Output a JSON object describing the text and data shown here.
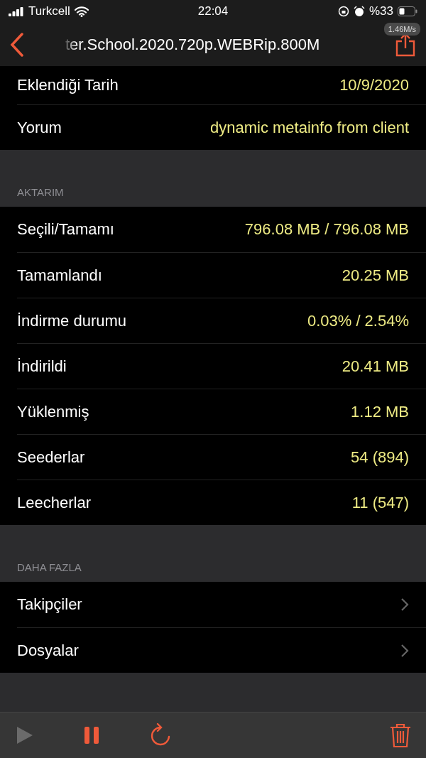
{
  "status_bar": {
    "carrier": "Turkcell",
    "time": "22:04",
    "battery": "%33"
  },
  "nav": {
    "title": "ter.School.2020.720p.WEBRip.800M",
    "speed": "1.46M/s"
  },
  "sections": [
    {
      "rows": [
        {
          "label": "Eklendiği Tarih",
          "value": "10/9/2020",
          "kind": "value"
        },
        {
          "label": "Yorum",
          "value": "dynamic metainfo from client",
          "kind": "value"
        }
      ]
    },
    {
      "header": "AKTARIM",
      "rows": [
        {
          "label": "Seçili/Tamamı",
          "value": "796.08 MB / 796.08 MB",
          "kind": "value"
        },
        {
          "label": "Tamamlandı",
          "value": "20.25 MB",
          "kind": "value"
        },
        {
          "label": "İndirme durumu",
          "value": "0.03% / 2.54%",
          "kind": "value"
        },
        {
          "label": "İndirildi",
          "value": "20.41 MB",
          "kind": "value"
        },
        {
          "label": "Yüklenmiş",
          "value": "1.12 MB",
          "kind": "value"
        },
        {
          "label": "Seederlar",
          "value": "54 (894)",
          "kind": "value"
        },
        {
          "label": "Leecherlar",
          "value": "11 (547)",
          "kind": "value"
        }
      ]
    },
    {
      "header": "DAHA FAZLA",
      "rows": [
        {
          "label": "Takipçiler",
          "kind": "link"
        },
        {
          "label": "Dosyalar",
          "kind": "link"
        }
      ]
    }
  ],
  "toolbar": [
    {
      "kind": "play",
      "disabled": true
    },
    {
      "kind": "pause",
      "disabled": false
    },
    {
      "kind": "refresh",
      "disabled": false
    },
    {
      "kind": "delete",
      "disabled": false
    }
  ]
}
